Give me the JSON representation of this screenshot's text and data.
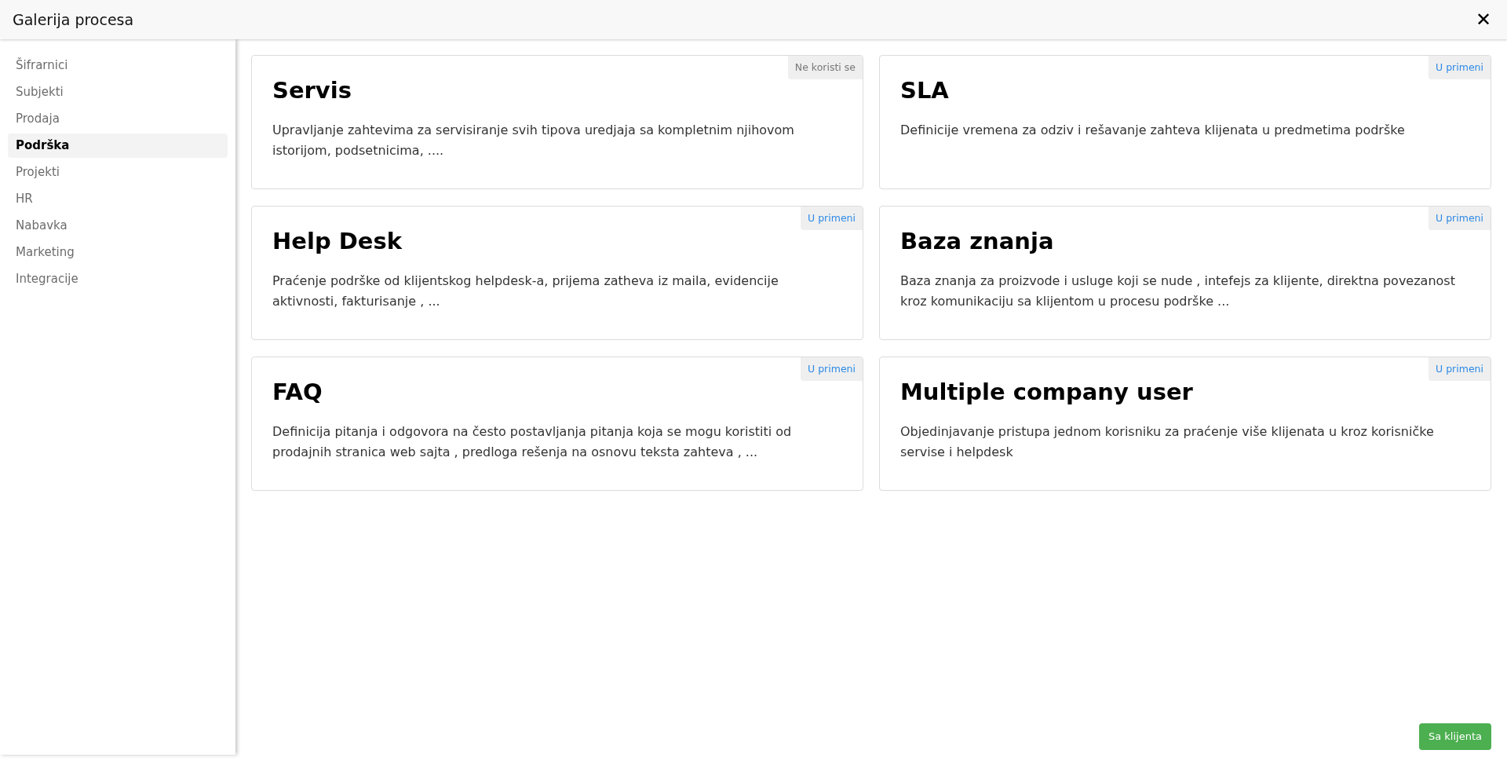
{
  "window": {
    "title": "Galerija procesa",
    "close": "✕"
  },
  "sidebar": {
    "items": [
      {
        "label": "Šifrarnici",
        "selected": false
      },
      {
        "label": "Subjekti",
        "selected": false
      },
      {
        "label": "Prodaja",
        "selected": false
      },
      {
        "label": "Podrška",
        "selected": true
      },
      {
        "label": "Projekti",
        "selected": false
      },
      {
        "label": "HR",
        "selected": false
      },
      {
        "label": "Nabavka",
        "selected": false
      },
      {
        "label": "Marketing",
        "selected": false
      },
      {
        "label": "Integracije",
        "selected": false
      }
    ]
  },
  "cards": [
    {
      "title": "Servis",
      "description": "Upravljanje zahtevima za servisiranje svih tipova uredjaja sa kompletnim njihovom istorijom, podsetnicima, ....",
      "badge": {
        "kind": "inactive",
        "label": "Ne koristi se"
      }
    },
    {
      "title": "SLA",
      "description": "Definicije vremena za odziv i rešavanje zahteva klijenata u predmetima podrške",
      "badge": {
        "kind": "active",
        "label": "U primeni"
      }
    },
    {
      "title": "Help Desk",
      "description": "Praćenje podrške od klijentskog helpdesk-a, prijema zatheva iz maila, evidencije aktivnosti, fakturisanje , ...",
      "badge": {
        "kind": "active",
        "label": "U primeni"
      }
    },
    {
      "title": "Baza znanja",
      "description": "Baza znanja za proizvode i usluge koji se nude , intefejs za klijente, direktna povezanost kroz komunikaciju sa klijentom u procesu podrške ...",
      "badge": {
        "kind": "active",
        "label": "U primeni"
      }
    },
    {
      "title": "FAQ",
      "description": "Definicija pitanja i odgovora na često postavljanja pitanja koja se mogu koristiti od prodajnih stranica web sajta , predloga rešenja na osnovu teksta zahteva , ...",
      "badge": {
        "kind": "active",
        "label": "U primeni"
      }
    },
    {
      "title": "Multiple company user",
      "description": "Objedinjavanje pristupa jednom korisniku za praćenje više klijenata u kroz korisničke servise i helpdesk",
      "badge": {
        "kind": "active",
        "label": "U primeni"
      }
    }
  ],
  "footer_button": "Sa klijenta"
}
